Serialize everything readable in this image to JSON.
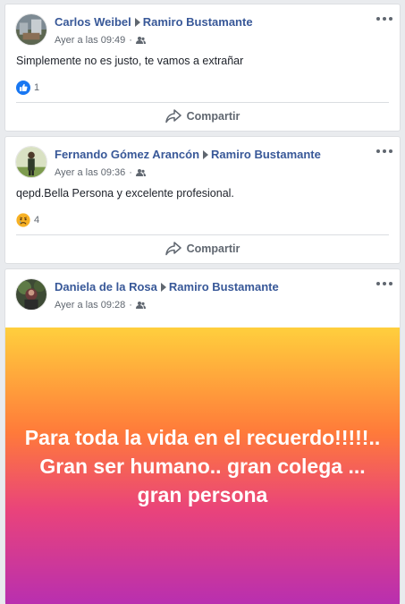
{
  "posts": [
    {
      "author": "Carlos Weibel",
      "target": "Ramiro Bustamante",
      "time": "Ayer a las 09:49",
      "separator": "·",
      "text": "Simplemente no es justo, te vamos a extrañar",
      "reaction_icon": "like-icon",
      "reaction_count": "1",
      "share_label": "Compartir"
    },
    {
      "author": "Fernando Gómez Arancón",
      "target": "Ramiro Bustamante",
      "time": "Ayer a las 09:36",
      "separator": "·",
      "text": "qepd.Bella Persona y excelente profesional.",
      "reaction_icon": "sad-icon",
      "reaction_count": "4",
      "share_label": "Compartir"
    },
    {
      "author": "Daniela de la Rosa",
      "target": "Ramiro Bustamante",
      "time": "Ayer a las 09:28",
      "separator": "·",
      "banner_text": "Para toda la vida en el recuerdo!!!!!.. Gran ser humano.. gran colega ... gran persona"
    }
  ],
  "colors": {
    "name_link": "#385898",
    "secondary_text": "#606770",
    "background": "#e9ebee",
    "like_blue": "#1877f2",
    "sad_yellow": "#f7b125",
    "banner_gradient": [
      "#ffcf3d",
      "#ff7a3a",
      "#e9437b",
      "#b82fb0"
    ]
  }
}
